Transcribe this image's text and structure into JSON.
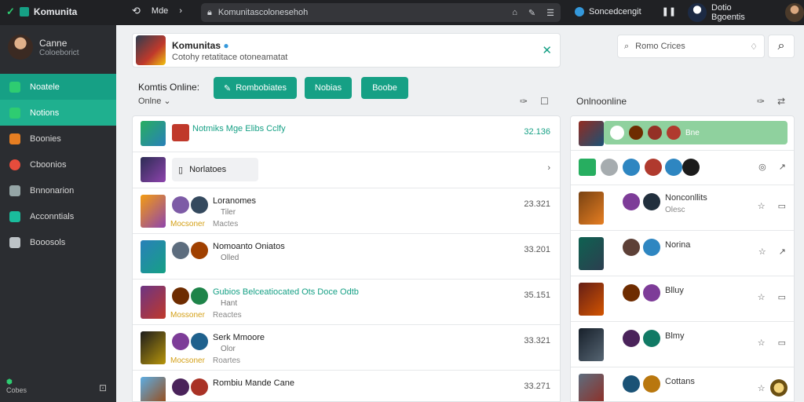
{
  "topbar": {
    "brand": "Komunita",
    "nav_label": "Mde",
    "url": "Komunitascolonesehoh",
    "extension": "Soncedcengit",
    "user_name": "Dotio Bgoentis"
  },
  "sidebar": {
    "profile_name": "Canne",
    "profile_sub": "Coloeborict",
    "items": [
      {
        "label": "Noatele",
        "color": "#2ecc71"
      },
      {
        "label": "Notions",
        "color": "#2ecc71"
      },
      {
        "label": "Boonies",
        "color": "#e67e22"
      },
      {
        "label": "Cboonios",
        "color": "#e74c3c"
      },
      {
        "label": "Bnnonarion",
        "color": "#95a5a6"
      },
      {
        "label": "Acconntials",
        "color": "#1abc9c"
      },
      {
        "label": "Booosols",
        "color": "#bdc3c7"
      }
    ],
    "bottom_label": "Cobes"
  },
  "header": {
    "title": "Komunitas",
    "subtitle": "Cotohy retatitace otoneamatat",
    "search_placeholder": "Romo Crices"
  },
  "filters": {
    "label": "Komtis Online:",
    "sub": "Onlne",
    "pills": [
      "Rombobiates",
      "Nobias",
      "Boobe"
    ]
  },
  "right_title": "Onlnoonline",
  "left_rows": [
    {
      "name": "Notmiks Mge Elibs Cclfy",
      "num": "32.136",
      "teal": true
    },
    {
      "name": "Norlatoes",
      "sub": true
    },
    {
      "name": "Loranomes",
      "sub_text": "Tiler",
      "tag": "Mocsoner",
      "tag2": "Mactes",
      "num": "23.321"
    },
    {
      "name": "Nomoanto Oniatos",
      "sub_text": "Olled",
      "num": "33.201"
    },
    {
      "name": "Gubios Belceatiocated Ots Doce Odtb",
      "sub_text": "Hant",
      "tag": "Mossoner",
      "tag2": "Reactes",
      "num": "35.151",
      "teal": true
    },
    {
      "name": "Serk Mmoore",
      "sub_text": "Olor",
      "tag": "Mocsoner",
      "tag2": "Roartes",
      "num": "33.321"
    },
    {
      "name": "Rombiu Mande Cane",
      "num": "33.271"
    }
  ],
  "right_rows": [
    {
      "label": "Bne"
    },
    {
      "label": ""
    },
    {
      "title": "Nonconllits",
      "sub": "Olesc"
    },
    {
      "title": "Norina"
    },
    {
      "title": "Blluy"
    },
    {
      "title": "Blmy"
    },
    {
      "title": "Cottans"
    }
  ]
}
